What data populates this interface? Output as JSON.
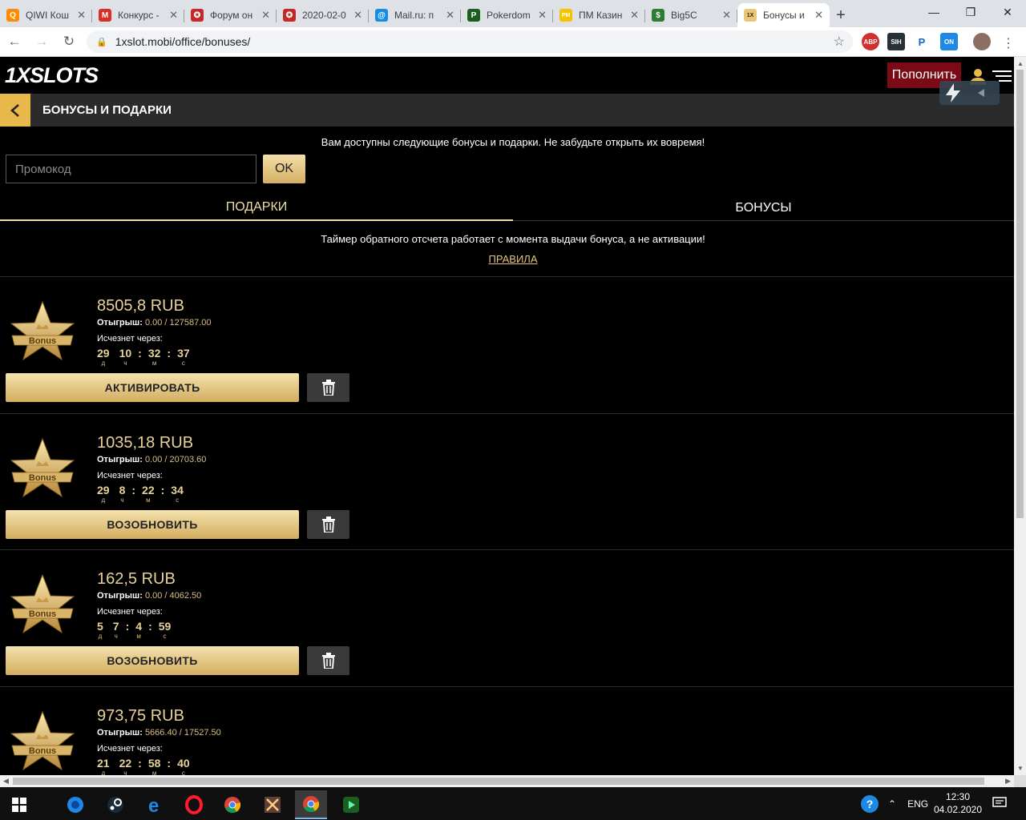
{
  "browser": {
    "tabs": [
      {
        "label": "QIWI Кош",
        "icon": "qiwi-icon",
        "color": "#ff8c00",
        "glyph": "Q"
      },
      {
        "label": "Конкурс -",
        "icon": "gmail-icon",
        "color": "#d93025",
        "glyph": "M"
      },
      {
        "label": "Форум он",
        "icon": "forum-icon",
        "color": "#c62828",
        "glyph": "✪"
      },
      {
        "label": "2020-02-0",
        "icon": "forum-icon",
        "color": "#c62828",
        "glyph": "✪"
      },
      {
        "label": "Mail.ru: п",
        "icon": "mailru-icon",
        "color": "#168de2",
        "glyph": "@"
      },
      {
        "label": "Pokerdom",
        "icon": "pokerdom-icon",
        "color": "#1b5e20",
        "glyph": "P"
      },
      {
        "label": "ПМ Казин",
        "icon": "pm-icon",
        "color": "#f5c400",
        "glyph": "PM"
      },
      {
        "label": "Big5C",
        "icon": "big5-icon",
        "color": "#2e7d32",
        "glyph": "$"
      },
      {
        "label": "Бонусы и",
        "icon": "1xslots-icon",
        "color": "#e7c77a",
        "glyph": "1X"
      }
    ],
    "url": "1xslot.mobi/office/bonuses/"
  },
  "header": {
    "logo_a": "1X",
    "logo_b": "SLOTS",
    "deposit_label": "Пополнить"
  },
  "title": "БОНУСЫ И ПОДАРКИ",
  "info_available": "Вам доступны следующие бонусы и подарки. Не забудьте открыть их вовремя!",
  "promo": {
    "placeholder": "Промокод",
    "ok_label": "OK"
  },
  "tabs": {
    "gifts": "ПОДАРКИ",
    "bonuses": "БОНУСЫ"
  },
  "timer_note": "Таймер обратного отсчета работает с момента выдачи бонуса, а не активации!",
  "rules_label": "ПРАВИЛА",
  "labels": {
    "wager": "Отыгрыш:",
    "expires": "Исчезнет через:",
    "days": "д",
    "hours": "ч",
    "minutes": "м",
    "seconds": "с",
    "badge": "Bonus"
  },
  "bonuses": [
    {
      "amount": "8505,8 RUB",
      "wager": "0.00 / 127587.00",
      "d": "29",
      "h": "10",
      "m": "32",
      "s": "37",
      "action": "АКТИВИРОВАТЬ"
    },
    {
      "amount": "1035,18 RUB",
      "wager": "0.00 / 20703.60",
      "d": "29",
      "h": "8",
      "m": "22",
      "s": "34",
      "action": "ВОЗОБНОВИТЬ"
    },
    {
      "amount": "162,5 RUB",
      "wager": "0.00 / 4062.50",
      "d": "5",
      "h": "7",
      "m": "4",
      "s": "59",
      "action": "ВОЗОБНОВИТЬ"
    },
    {
      "amount": "973,75 RUB",
      "wager": "5666.40 / 17527.50",
      "d": "21",
      "h": "22",
      "m": "58",
      "s": "40",
      "action": ""
    }
  ],
  "taskbar": {
    "lang": "ENG",
    "time": "12:30",
    "date": "04.02.2020"
  }
}
